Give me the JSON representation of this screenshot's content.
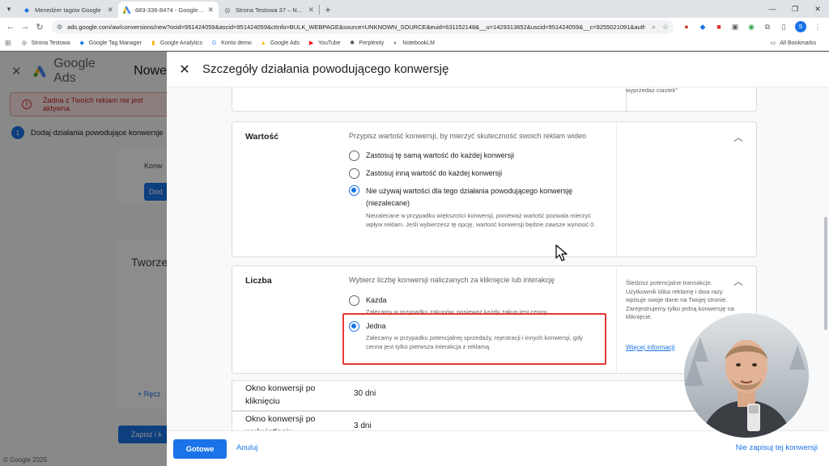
{
  "browser": {
    "tabs": [
      {
        "title": "Menedżer tagów Google",
        "active": false
      },
      {
        "title": "683-336-8474 - Google Ads",
        "active": true
      },
      {
        "title": "Strona Testowa 37 – Na tej stro...",
        "active": false
      }
    ],
    "url": "ads.google.com/aw/conversions/new?ocid=951424059&ascid=951424059&ctInfo=BULK_WEBPAGE&source=UNKNOWN_SOURCE&euid=631152148&__u=1429313652&uscid=951424059&__c=9255021091&authuser=0",
    "bookmarks": [
      "Strona Testowa",
      "Google Tag Manager",
      "Google Analytics",
      "Konto demo",
      "Google Ads",
      "YouTube",
      "Perplexity",
      "NotebookLM"
    ],
    "all_bookmarks": "All Bookmarks"
  },
  "background": {
    "brand": "Google Ads",
    "nowe": "Nowe",
    "alert": "Żadna z Twoich reklam nie jest aktywna",
    "step_number": "1",
    "step_label": "Dodaj działania powodujące konwersje",
    "card1_text": "Konw",
    "card1_button": "Dod",
    "card2_title": "Tworze",
    "card2_link": "+ Ręcz",
    "save": "Zapisz i k",
    "copyright": "© Google 2025"
  },
  "dialog": {
    "title": "Szczegóły działania powodującego konwersję",
    "top_note": "wyprzedaż ciastek\"",
    "value": {
      "title": "Wartość",
      "desc": "Przypisz wartość konwersji, by mierzyć skuteczność swoich reklam wideo",
      "options": [
        {
          "label": "Zastosuj tę samą wartość do każdej konwersji",
          "selected": false
        },
        {
          "label": "Zastosuj inną wartość do każdej konwersji",
          "selected": false
        },
        {
          "label": "Nie używaj wartości dla tego działania powodującego konwersję (niezalecane)",
          "selected": true,
          "hint": "Niezalecane w przypadku większości konwersji, ponieważ wartość pozwala mierzyć wpływ reklam. Jeśli wybierzesz tę opcję, wartość konwersji będzie zawsze wynosić 0."
        }
      ]
    },
    "count": {
      "title": "Liczba",
      "desc": "Wybierz liczbę konwersji naliczanych za kliknięcie lub interakcję",
      "options": [
        {
          "label": "Każda",
          "selected": false,
          "hint": "Zalecamy w przypadku zakupów, ponieważ każdy zakup jest cenny."
        },
        {
          "label": "Jedna",
          "selected": true,
          "hint": "Zalecamy w przypadku potencjalnej sprzedaży, rejestracji i innych konwersji, gdy cenna jest tylko pierwsza interakcja z reklamą."
        }
      ],
      "side_info": "Śledzisz potencjalne transakcje. Użytkownik klika reklamę i dwa razy wpisuje swoje dane na Twojej stronie. Zarejestrujemy tylko jedną konwersję na kliknięcie.",
      "side_link": "Więcej informacji"
    },
    "click_window": {
      "label": "Okno konwersji po kliknięciu",
      "value": "30 dni"
    },
    "view_window": {
      "label": "Okno konwersji po wyświetleniu",
      "value": "3 dni"
    },
    "footer": {
      "done": "Gotowe",
      "cancel": "Anuluj",
      "dont_save": "Nie zapisuj tej konwersji"
    }
  },
  "colors": {
    "accent": "#1a73e8",
    "highlight": "#e53935",
    "alert": "#d93025"
  }
}
